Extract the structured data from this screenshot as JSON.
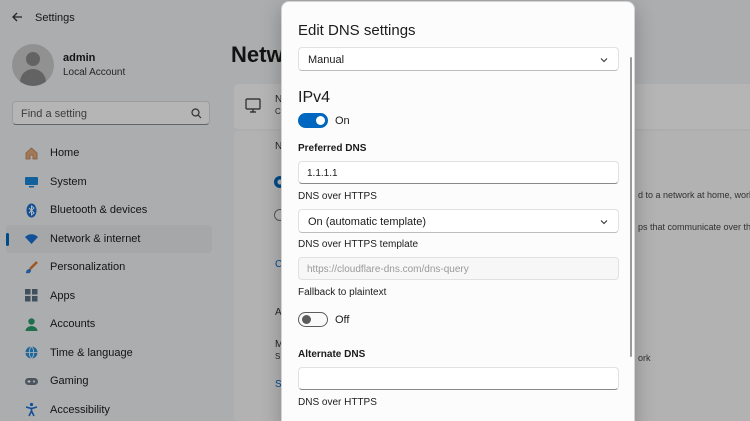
{
  "window": {
    "title": "Settings"
  },
  "profile": {
    "name": "admin",
    "account": "Local Account"
  },
  "search": {
    "placeholder": "Find a setting"
  },
  "sidebar": {
    "items": [
      {
        "label": "Home",
        "icon": "home-icon"
      },
      {
        "label": "System",
        "icon": "system-icon"
      },
      {
        "label": "Bluetooth & devices",
        "icon": "bluetooth-icon"
      },
      {
        "label": "Network & internet",
        "icon": "wifi-icon",
        "active": true
      },
      {
        "label": "Personalization",
        "icon": "brush-icon"
      },
      {
        "label": "Apps",
        "icon": "apps-icon"
      },
      {
        "label": "Accounts",
        "icon": "person-icon"
      },
      {
        "label": "Time & language",
        "icon": "globe-icon"
      },
      {
        "label": "Gaming",
        "icon": "gamepad-icon"
      },
      {
        "label": "Accessibility",
        "icon": "accessibility-icon"
      }
    ]
  },
  "page": {
    "heading": "Netw",
    "fragments": {
      "n1": "N",
      "c1": "C",
      "n2": "N",
      "c2": "C",
      "a1": "A",
      "m1": "M",
      "s1": "S",
      "s2": "S",
      "t1": "d to a network at home, work,",
      "t2": "ps that communicate over thi",
      "t3": "ork"
    }
  },
  "dialog": {
    "title": "Edit DNS settings",
    "mode_value": "Manual",
    "ipv4_title": "IPv4",
    "ipv4_toggle_label": "On",
    "preferred_dns_label": "Preferred DNS",
    "preferred_dns_value": "1.1.1.1",
    "doh_label": "DNS over HTTPS",
    "doh_value": "On (automatic template)",
    "doh_template_label": "DNS over HTTPS template",
    "doh_template_value": "https://cloudflare-dns.com/dns-query",
    "fallback_label": "Fallback to plaintext",
    "fallback_toggle_label": "Off",
    "alternate_dns_label": "Alternate DNS",
    "alternate_dns_value": "",
    "doh2_label": "DNS over HTTPS"
  },
  "colors": {
    "accent": "#0067c0"
  }
}
